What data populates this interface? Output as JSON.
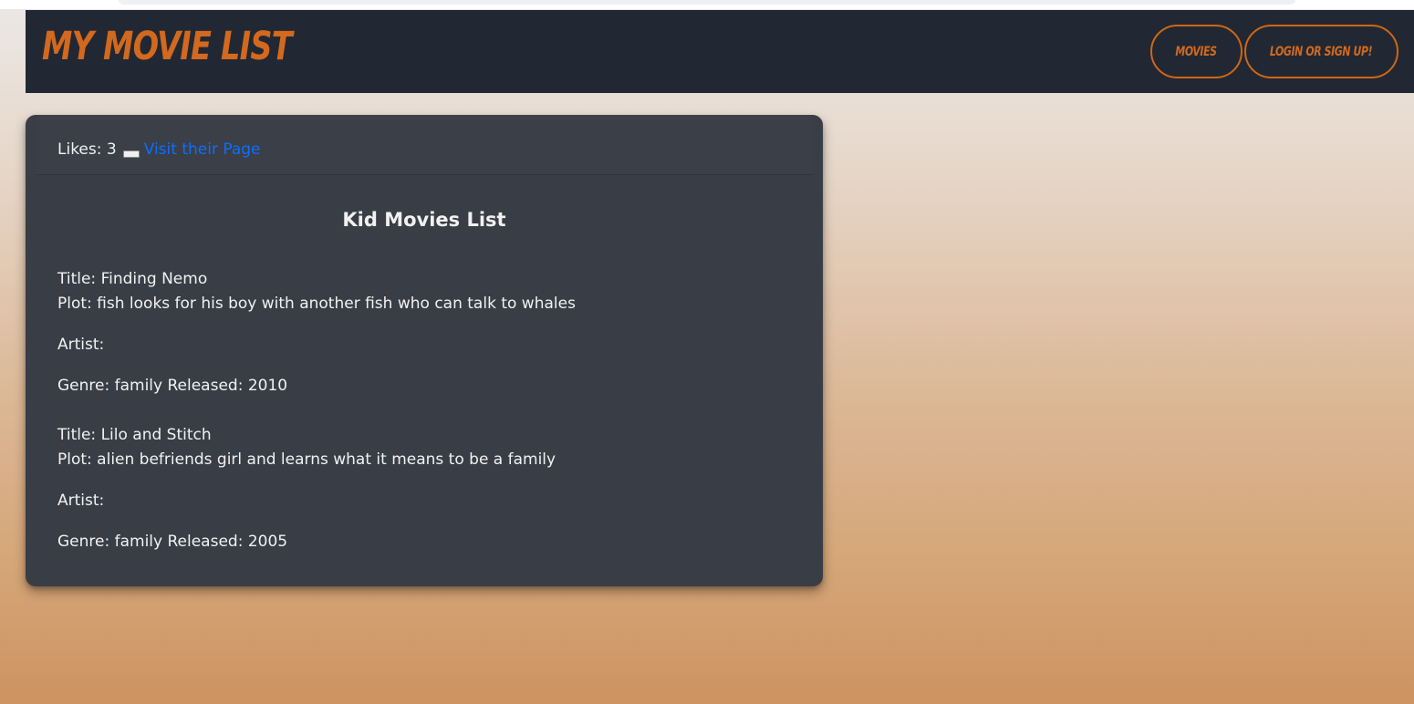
{
  "navbar": {
    "brand": "MY MOVIE LIST",
    "buttons": {
      "movies": "MOVIES",
      "login": "LOGIN OR SIGN UP!"
    }
  },
  "colors": {
    "accent": "#d2691e",
    "navbar_bg": "#212834",
    "card_bg": "#393d46",
    "link": "#0d6efd"
  },
  "card": {
    "likes_label": "Likes: 3",
    "visit_link": "Visit their Page",
    "list_title": "Kid Movies List",
    "movies": [
      {
        "title": "Title: Finding Nemo",
        "plot": "Plot: fish looks for his boy with another fish who can talk to whales",
        "artist": "Artist:",
        "genre_released": "Genre: family Released: 2010"
      },
      {
        "title": "Title: Lilo and Stitch",
        "plot": "Plot: alien befriends girl and learns what it means to be a family",
        "artist": "Artist:",
        "genre_released": "Genre: family Released: 2005"
      }
    ]
  }
}
